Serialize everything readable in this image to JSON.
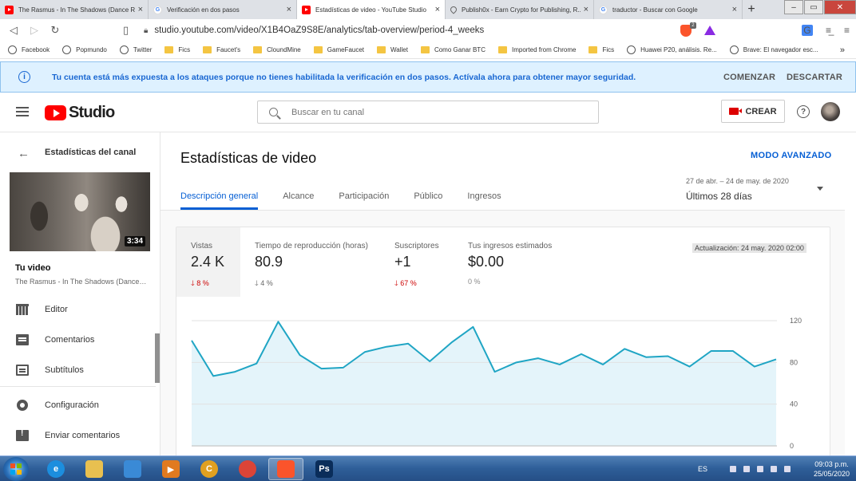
{
  "browser": {
    "tabs": [
      {
        "title": "The Rasmus - In The Shadows (Dance Re...",
        "icon": "youtube-icon",
        "active": false
      },
      {
        "title": "Verificación en dos pasos",
        "icon": "google-icon",
        "active": false
      },
      {
        "title": "Estadísticas de video - YouTube Studio",
        "icon": "youtube-icon",
        "active": true
      },
      {
        "title": "Publish0x - Earn Crypto for Publishing, R...",
        "icon": "drop-icon",
        "active": false
      },
      {
        "title": "traductor - Buscar con Google",
        "icon": "google-icon",
        "active": false
      }
    ],
    "url": "studio.youtube.com/video/X1B4OaZ9S8E/analytics/tab-overview/period-4_weeks",
    "bookmarks": [
      {
        "label": "Facebook",
        "icon": "globe"
      },
      {
        "label": "Popmundo",
        "icon": "globe"
      },
      {
        "label": "Twitter",
        "icon": "globe"
      },
      {
        "label": "Fics",
        "icon": "folder"
      },
      {
        "label": "Faucet's",
        "icon": "folder"
      },
      {
        "label": "CloundMine",
        "icon": "folder"
      },
      {
        "label": "GameFaucet",
        "icon": "folder"
      },
      {
        "label": "Wallet",
        "icon": "folder"
      },
      {
        "label": "Como Ganar BTC",
        "icon": "folder"
      },
      {
        "label": "Imported from Chrome",
        "icon": "folder"
      },
      {
        "label": "Fics",
        "icon": "folder"
      },
      {
        "label": "Huawei P20, análisis. Re...",
        "icon": "globe"
      },
      {
        "label": "Brave: El navegador esc...",
        "icon": "globe"
      }
    ],
    "bookmarks_more": "»"
  },
  "banner": {
    "text": "Tu cuenta está más expuesta a los ataques porque no tienes habilitada la verificación en dos pasos. Actívala ahora para obtener mayor seguridad.",
    "start_label": "COMENZAR",
    "dismiss_label": "DESCARTAR",
    "color": "#1967d2"
  },
  "header": {
    "logo_text": "Studio",
    "search_placeholder": "Buscar en tu canal",
    "create_label": "CREAR",
    "help_glyph": "?"
  },
  "sidebar": {
    "title": "Estadísticas del canal",
    "duration": "3:34",
    "video_label": "Tu video",
    "video_name": "The Rasmus - In The Shadows (Dance Remix)",
    "items": [
      {
        "label": "Editor",
        "icon": "film-icon"
      },
      {
        "label": "Comentarios",
        "icon": "comment-icon"
      },
      {
        "label": "Subtítulos",
        "icon": "subtitles-icon"
      },
      {
        "label": "Configuración",
        "icon": "gear-icon"
      },
      {
        "label": "Enviar comentarios",
        "icon": "feedback-icon"
      }
    ]
  },
  "main": {
    "title": "Estadísticas de video",
    "advanced_mode": "MODO AVANZADO",
    "tabs": [
      {
        "label": "Descripción general",
        "active": true
      },
      {
        "label": "Alcance",
        "active": false
      },
      {
        "label": "Participación",
        "active": false
      },
      {
        "label": "Público",
        "active": false
      },
      {
        "label": "Ingresos",
        "active": false
      }
    ],
    "period": {
      "range": "27 de abr. – 24 de may. de 2020",
      "label": "Últimos 28 días"
    },
    "metrics": [
      {
        "name": "Vistas",
        "value": "2.4 K",
        "delta": "8 %",
        "direction": "down",
        "color": "#cc0000"
      },
      {
        "name": "Tiempo de reproducción (horas)",
        "value": "80.9",
        "delta": "4 %",
        "direction": "down",
        "color": "#666666"
      },
      {
        "name": "Suscriptores",
        "value": "+1",
        "delta": "67 %",
        "direction": "down",
        "color": "#cc0000"
      },
      {
        "name": "Tus ingresos estimados",
        "value": "$0.00",
        "delta": "0 %",
        "direction": "none",
        "color": "#888888"
      }
    ],
    "updated": "Actualización: 24 may. 2020 02:00"
  },
  "chart_data": {
    "type": "area",
    "y_ticks": [
      "120",
      "80",
      "40",
      "0"
    ],
    "ylim": [
      0,
      120
    ],
    "grid": true,
    "line_color": "#1fa5c4",
    "fill_color": "#e4f4fa",
    "values": [
      101,
      67,
      71,
      79,
      119,
      87,
      74,
      75,
      90,
      95,
      98,
      81,
      99,
      114,
      71,
      80,
      84,
      78,
      88,
      78,
      93,
      85,
      86,
      76,
      91,
      91,
      76,
      83
    ]
  },
  "taskbar": {
    "apps": [
      {
        "name": "ie-icon",
        "glyph": "e",
        "color": "#1c8ede"
      },
      {
        "name": "explorer-icon",
        "glyph": "",
        "color": "#e8c050"
      },
      {
        "name": "network-icon",
        "glyph": "",
        "color": "#3a8ad6"
      },
      {
        "name": "media-player-icon",
        "glyph": "▶",
        "color": "#e07a20"
      },
      {
        "name": "ccleaner-icon",
        "glyph": "C",
        "color": "#e0a020"
      },
      {
        "name": "chrome-icon",
        "glyph": "",
        "color": "#db4437"
      },
      {
        "name": "brave-icon",
        "glyph": "",
        "color": "#fb542b",
        "active": true
      },
      {
        "name": "photoshop-icon",
        "glyph": "Ps",
        "color": "#0a2d5a"
      }
    ],
    "language": "ES",
    "time": "09:03 p.m.",
    "date": "25/05/2020"
  }
}
